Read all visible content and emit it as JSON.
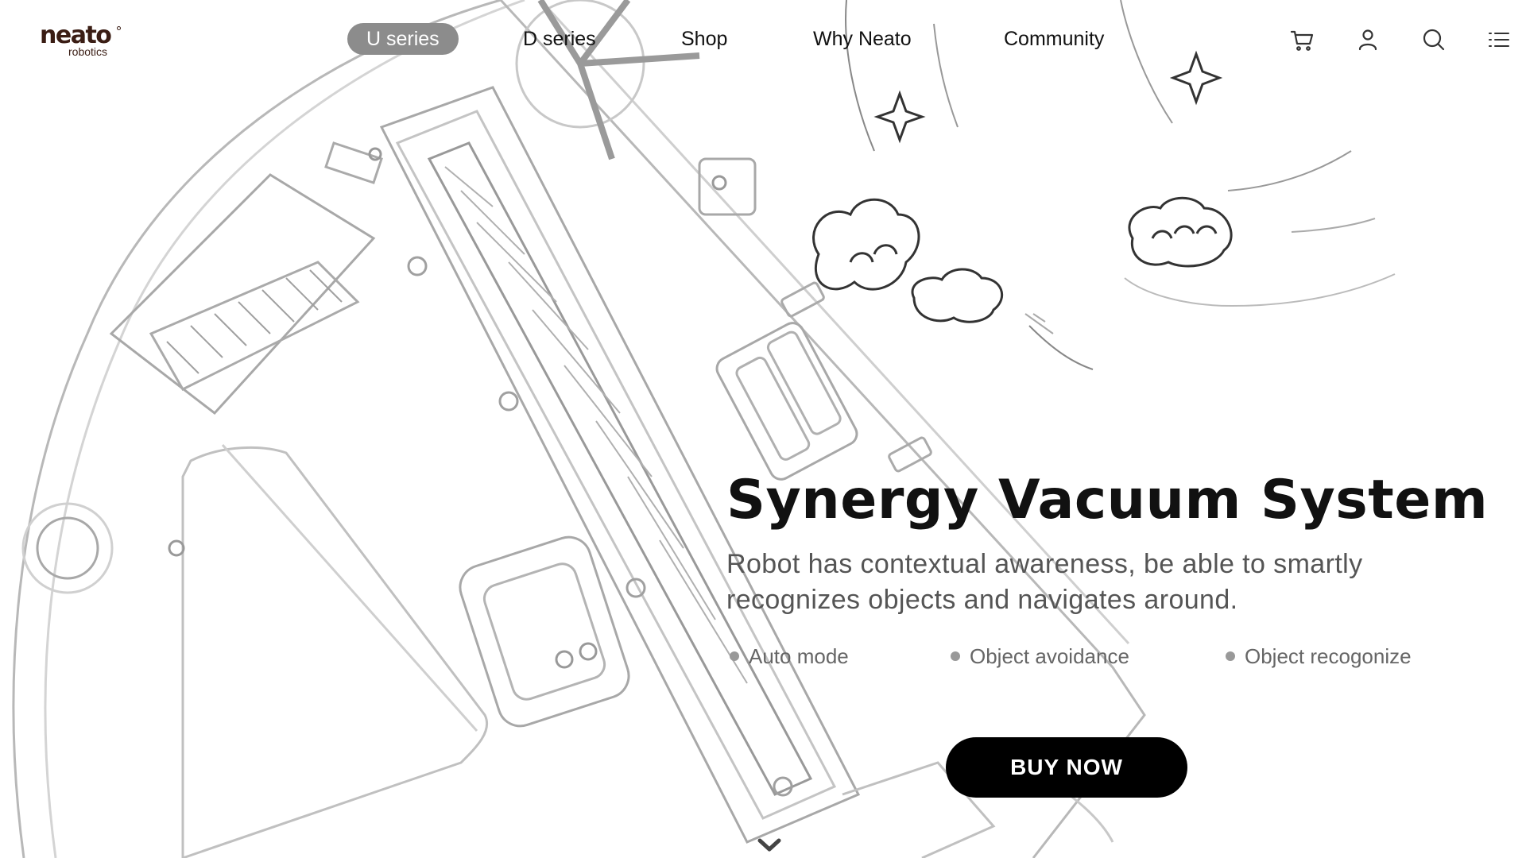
{
  "brand": {
    "name": "neato",
    "tagline": "robotics"
  },
  "nav": {
    "items": [
      {
        "label": "U series",
        "active": true
      },
      {
        "label": "D series",
        "active": false
      },
      {
        "label": "Shop",
        "active": false
      },
      {
        "label": "Why Neato",
        "active": false
      },
      {
        "label": "Community",
        "active": false
      }
    ]
  },
  "header_icons": [
    "cart-icon",
    "user-icon",
    "search-icon",
    "menu-list-icon"
  ],
  "hero": {
    "title": "Synergy Vacuum System",
    "subtitle": "Robot has contextual awareness, be able to smartly recognizes objects and navigates around.",
    "features": [
      "Auto mode",
      "Object avoidance",
      "Object recogonize"
    ],
    "cta": "BUY NOW"
  },
  "colors": {
    "active_pill": "#8c8c8c",
    "cta_bg": "#000000",
    "logo": "#3a1d14",
    "subtitle": "#555555"
  }
}
